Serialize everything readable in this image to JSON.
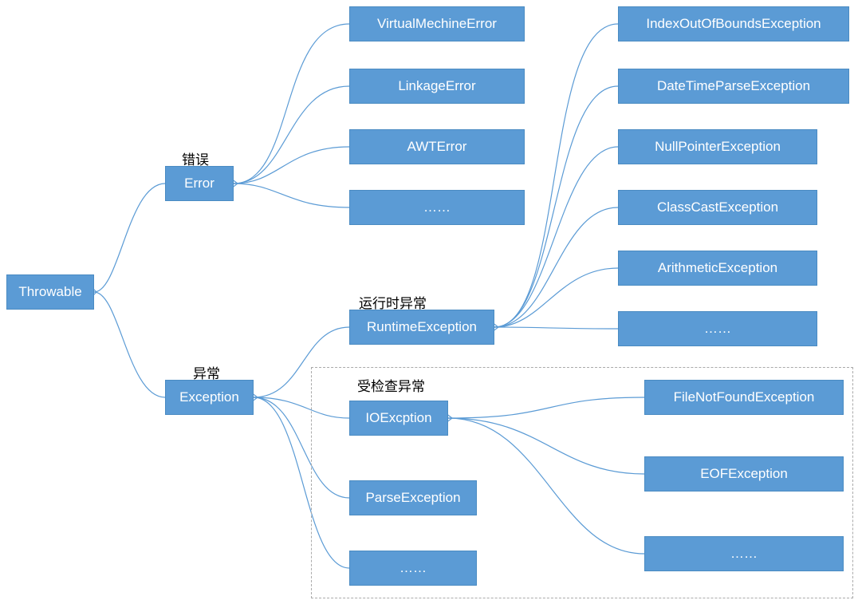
{
  "root": {
    "label": "Throwable"
  },
  "error": {
    "annotation": "错误",
    "label": "Error",
    "children": [
      "VirtualMechineError",
      "LinkageError",
      "AWTError",
      "……"
    ]
  },
  "exception": {
    "annotation": "异常",
    "label": "Exception",
    "runtime": {
      "annotation": "运行时异常",
      "label": "RuntimeException",
      "children": [
        "IndexOutOfBoundsException",
        "DateTimeParseException",
        "NullPointerException",
        "ClassCastException",
        "ArithmeticException",
        "……"
      ]
    },
    "checked": {
      "annotation": "受检查异常",
      "ioexception": {
        "label": "IOExcption",
        "children": [
          "FileNotFoundException",
          "EOFException"
        ]
      },
      "parse": {
        "label": "ParseException"
      },
      "more": {
        "label": "……"
      },
      "rightMore": {
        "label": "……"
      }
    }
  }
}
